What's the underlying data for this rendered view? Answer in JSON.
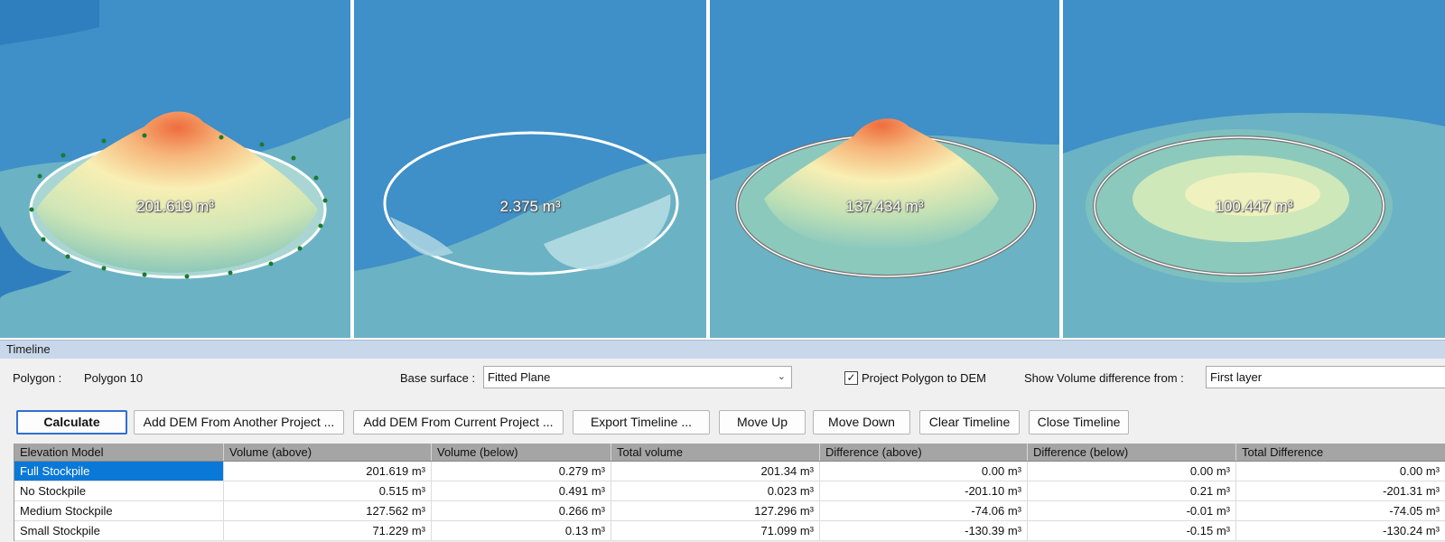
{
  "views": [
    {
      "label": "201.619 m³"
    },
    {
      "label": "2.375 m³"
    },
    {
      "label": "137.434 m³"
    },
    {
      "label": "100.447 m³"
    }
  ],
  "colors": {
    "water": "#3f8fc8",
    "water_dark": "#2f7fbe",
    "ground": "#6bb2c4",
    "highlight_row": "#0a78d7",
    "header_bar": "#c9d7ea",
    "grid_header": "#a5a5a5"
  },
  "timeline": {
    "title": "Timeline",
    "polygon_label": "Polygon :",
    "polygon_value": "Polygon 10",
    "base_surface_label": "Base surface :",
    "base_surface_value": "Fitted Plane",
    "project_polygon_label": "Project Polygon to DEM",
    "project_polygon_checked": true,
    "show_diff_label": "Show Volume difference from :",
    "show_diff_value": "First layer",
    "buttons": {
      "calculate": "Calculate",
      "add_dem_other": "Add DEM From Another Project ...",
      "add_dem_current": "Add DEM From Current Project ...",
      "export_timeline": "Export Timeline ...",
      "move_up": "Move Up",
      "move_down": "Move Down",
      "clear_timeline": "Clear Timeline",
      "close_timeline": "Close Timeline"
    },
    "table": {
      "columns": [
        "Elevation Model",
        "Volume (above)",
        "Volume (below)",
        "Total volume",
        "Difference (above)",
        "Difference (below)",
        "Total Difference"
      ],
      "rows": [
        [
          "Full Stockpile",
          "201.619 m³",
          "0.279 m³",
          "201.34 m³",
          "0.00 m³",
          "0.00 m³",
          "0.00 m³"
        ],
        [
          "No Stockpile",
          "0.515 m³",
          "0.491 m³",
          "0.023 m³",
          "-201.10 m³",
          "0.21 m³",
          "-201.31 m³"
        ],
        [
          "Medium Stockpile",
          "127.562 m³",
          "0.266 m³",
          "127.296 m³",
          "-74.06 m³",
          "-0.01 m³",
          "-74.05 m³"
        ],
        [
          "Small Stockpile",
          "71.229 m³",
          "0.13 m³",
          "71.099 m³",
          "-130.39 m³",
          "-0.15 m³",
          "-130.24 m³"
        ]
      ],
      "selected_row": 0
    }
  }
}
